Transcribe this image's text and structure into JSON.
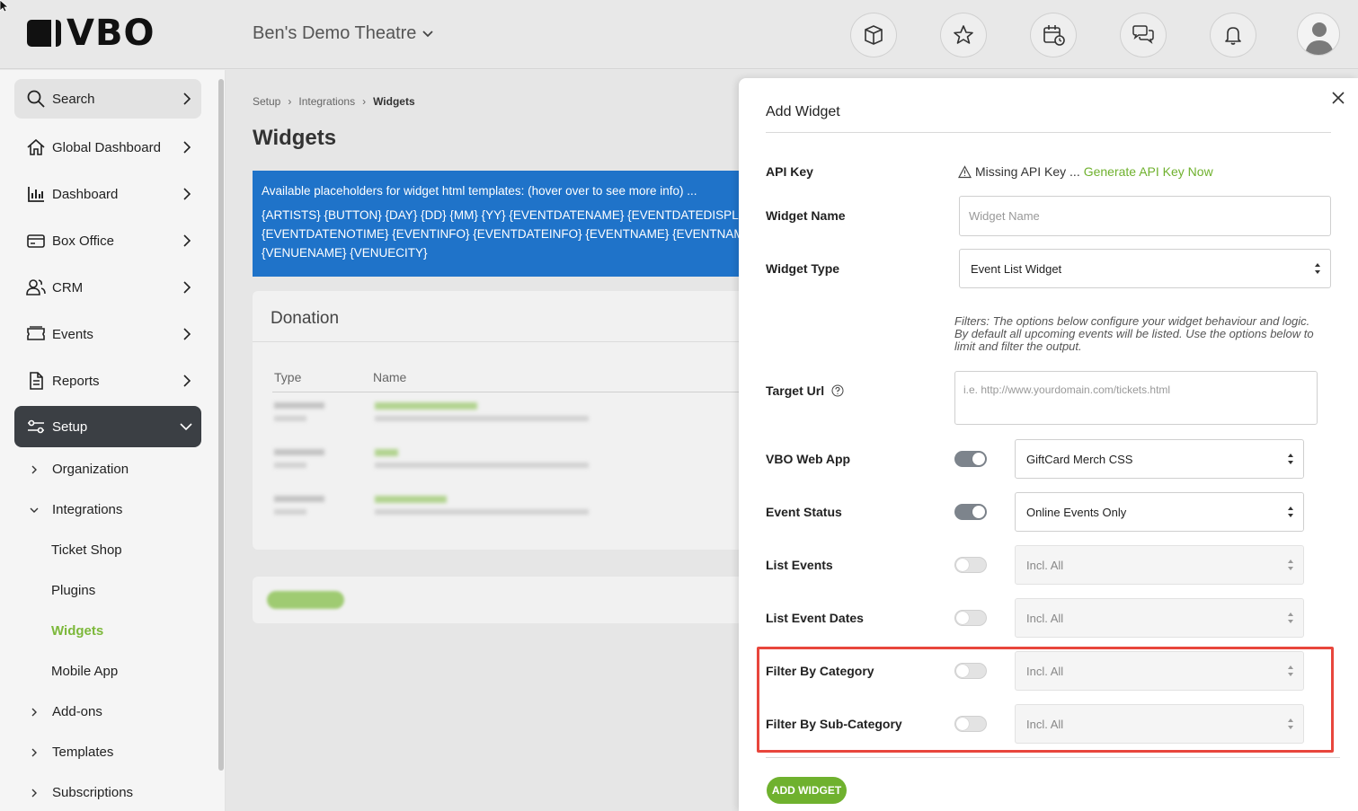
{
  "brand": {
    "logo_text": "VBO"
  },
  "header": {
    "venue_name": "Ben's Demo Theatre",
    "icons": [
      "box-icon",
      "star-icon",
      "calendar-clock-icon",
      "chat-icon",
      "bell-icon"
    ]
  },
  "sidebar": {
    "items": [
      {
        "label": "Search",
        "icon": "search-icon"
      },
      {
        "label": "Global Dashboard",
        "icon": "home-icon"
      },
      {
        "label": "Dashboard",
        "icon": "bar-chart-icon"
      },
      {
        "label": "Box Office",
        "icon": "card-icon"
      },
      {
        "label": "CRM",
        "icon": "users-icon"
      },
      {
        "label": "Events",
        "icon": "ticket-icon"
      },
      {
        "label": "Reports",
        "icon": "document-icon"
      },
      {
        "label": "Setup",
        "icon": "sliders-icon"
      }
    ],
    "setup_children": {
      "organization": "Organization",
      "integrations": "Integrations",
      "integrations_children": [
        "Ticket Shop",
        "Plugins",
        "Widgets",
        "Mobile App"
      ],
      "add_ons": "Add-ons",
      "templates": "Templates",
      "subscriptions": "Subscriptions"
    }
  },
  "main": {
    "breadcrumb": [
      "Setup",
      "Integrations",
      "Widgets"
    ],
    "title": "Widgets",
    "info": {
      "line1": "Available placeholders for widget html templates: (hover over to see more info) ...",
      "line2": "{ARTISTS} {BUTTON} {DAY} {DD} {MM} {YY} {EVENTDATENAME} {EVENTDATEDISPLAY",
      "line3": "{EVENTDATENOTIME} {EVENTINFO} {EVENTDATEINFO} {EVENTNAME} {EVENTNAMEL",
      "line4": "{VENUENAME} {VENUECITY}"
    },
    "donation_card": {
      "title": "Donation",
      "columns": [
        "Type",
        "Name"
      ]
    }
  },
  "modal": {
    "title": "Add Widget",
    "api_key_label": "API Key",
    "api_key_missing": "Missing API Key ...",
    "api_key_link": "Generate API Key Now",
    "widget_name_label": "Widget Name",
    "widget_name_placeholder": "Widget Name",
    "widget_type_label": "Widget Type",
    "widget_type_value": "Event List Widget",
    "filters_note": "Filters: The options below configure your widget behaviour and logic. By default all upcoming events will be listed. Use the options below to limit and filter the output.",
    "target_url_label": "Target Url",
    "target_url_placeholder": "i.e. http://www.yourdomain.com/tickets.html",
    "rows": [
      {
        "label": "VBO Web App",
        "toggle": true,
        "value": "GiftCard Merch CSS"
      },
      {
        "label": "Event Status",
        "toggle": true,
        "value": "Online Events Only"
      },
      {
        "label": "List Events",
        "toggle": false,
        "value": "Incl. All"
      },
      {
        "label": "List Event Dates",
        "toggle": false,
        "value": "Incl. All"
      },
      {
        "label": "Filter By Category",
        "toggle": false,
        "value": "Incl. All"
      },
      {
        "label": "Filter By Sub-Category",
        "toggle": false,
        "value": "Incl. All"
      }
    ],
    "add_button": "ADD WIDGET"
  },
  "colors": {
    "accent_green": "#6fb12e",
    "info_blue": "#1f73c9",
    "highlight_red": "#e8463c",
    "setup_dark": "#3b3f44"
  }
}
